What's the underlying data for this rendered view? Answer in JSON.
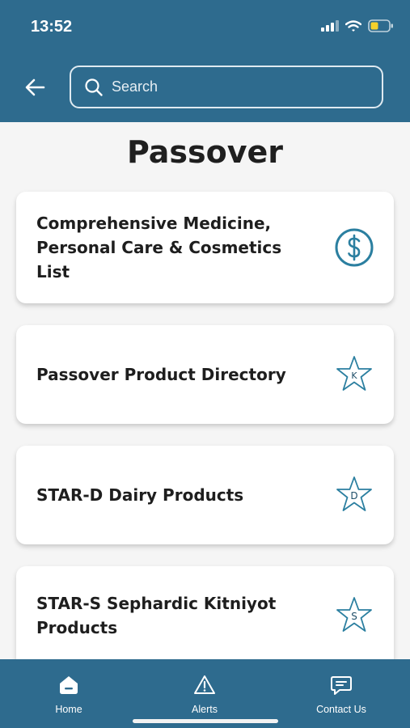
{
  "status": {
    "time": "13:52"
  },
  "search": {
    "placeholder": "Search"
  },
  "page": {
    "title": "Passover"
  },
  "items": [
    {
      "label": "Comprehensive Medicine, Personal Care & Cosmetics List",
      "icon": "dollar-circle-icon"
    },
    {
      "label": "Passover Product Directory",
      "icon": "star-k-icon",
      "badge": "K"
    },
    {
      "label": "STAR-D Dairy Products",
      "icon": "star-d-icon",
      "badge": "D"
    },
    {
      "label": "STAR-S Sephardic Kitniyot Products",
      "icon": "star-s-icon",
      "badge": "S"
    }
  ],
  "tabs": [
    {
      "label": "Home",
      "icon": "home-icon"
    },
    {
      "label": "Alerts",
      "icon": "alert-triangle-icon"
    },
    {
      "label": "Contact Us",
      "icon": "chat-icon"
    }
  ],
  "colors": {
    "brand": "#2e6b8e",
    "icon": "#2b7fa0",
    "background": "#f5f5f5"
  }
}
